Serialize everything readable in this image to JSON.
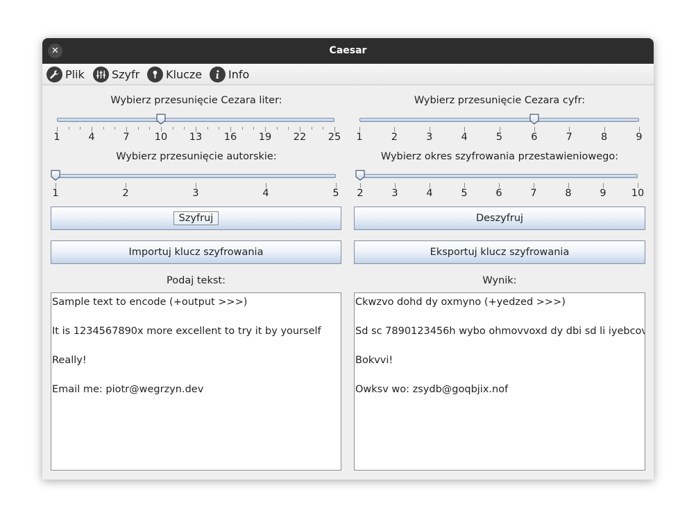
{
  "window": {
    "title": "Caesar"
  },
  "menu": [
    {
      "label": "Plik",
      "icon": "wrench-icon"
    },
    {
      "label": "Szyfr",
      "icon": "sliders-icon"
    },
    {
      "label": "Klucze",
      "icon": "key-icon"
    },
    {
      "label": "Info",
      "icon": "info-icon"
    }
  ],
  "sliders": {
    "letters": {
      "label": "Wybierz przesunięcie Cezara liter:",
      "min": 1,
      "max": 25,
      "value": 10,
      "tick_labels": [
        "1",
        "4",
        "7",
        "10",
        "13",
        "16",
        "19",
        "22",
        "25"
      ]
    },
    "digits": {
      "label": "Wybierz przesunięcie Cezara cyfr:",
      "min": 1,
      "max": 9,
      "value": 6,
      "tick_labels": [
        "1",
        "2",
        "3",
        "4",
        "5",
        "6",
        "7",
        "8",
        "9"
      ]
    },
    "author": {
      "label": "Wybierz przesunięcie autorskie:",
      "min": 1,
      "max": 5,
      "value": 1,
      "tick_labels": [
        "1",
        "2",
        "3",
        "4",
        "5"
      ]
    },
    "period": {
      "label": "Wybierz okres szyfrowania przestawieniowego:",
      "min": 2,
      "max": 10,
      "value": 2,
      "tick_labels": [
        "2",
        "3",
        "4",
        "5",
        "6",
        "7",
        "8",
        "9",
        "10"
      ]
    }
  },
  "buttons": {
    "encrypt": "Szyfruj",
    "decrypt": "Deszyfruj",
    "import_key": "Importuj klucz szyfrowania",
    "export_key": "Eksportuj klucz szyfrowania"
  },
  "input": {
    "label": "Podaj tekst:",
    "text": "Sample text to encode (+output >>>)\n\nIt is 1234567890x more excellent to try it by yourself\n\nReally!\n\nEmail me: piotr@wegrzyn.dev"
  },
  "output": {
    "label": "Wynik:",
    "text": "Ckwzvo dohd dy oxmyno (+yedzed >>>)\n\nSd sc 7890123456h wybo ohmovvoxd dy dbi sd li iyebcovp\n\nBokvvi!\n\nOwksv wo: zsydb@goqbjix.nof"
  }
}
